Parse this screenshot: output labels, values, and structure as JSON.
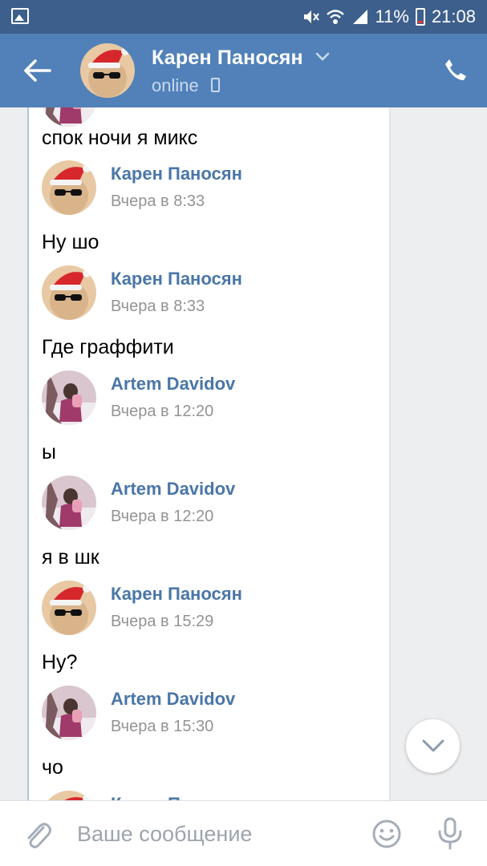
{
  "status_bar": {
    "battery_percent": "11%",
    "time": "21:08"
  },
  "header": {
    "contact_name": "Карен Паносян",
    "status": "online"
  },
  "messages": [
    {
      "text": "спок ночи я микс"
    },
    {
      "author": "Карен Паносян",
      "time": "Вчера в 8:33",
      "text": "Ну  шо"
    },
    {
      "author": "Карен Паносян",
      "time": "Вчера в 8:33",
      "text": "Где граффити"
    },
    {
      "author": "Artem Davidov",
      "time": "Вчера в 12:20",
      "text": "ы"
    },
    {
      "author": "Artem Davidov",
      "time": "Вчера в 12:20",
      "text": "я в шк"
    },
    {
      "author": "Карен Паносян",
      "time": "Вчера в 15:29",
      "text": "Ну?"
    },
    {
      "author": "Artem Davidov",
      "time": "Вчера в 15:30",
      "text": "чо"
    },
    {
      "author": "Карен Паносян"
    }
  ],
  "composer": {
    "placeholder": "Ваше сообщение"
  },
  "colors": {
    "header_bg": "#5181b8",
    "status_bar_bg": "#3d5f8c",
    "author_name": "#4a76a8",
    "timestamp": "#939393"
  },
  "icons": [
    "gallery-icon",
    "mute-icon",
    "wifi-icon",
    "signal-icon",
    "battery-icon",
    "back-arrow-icon",
    "chevron-down-icon",
    "phone-call-icon",
    "chevron-down-icon",
    "paperclip-icon",
    "smiley-icon",
    "microphone-icon"
  ]
}
